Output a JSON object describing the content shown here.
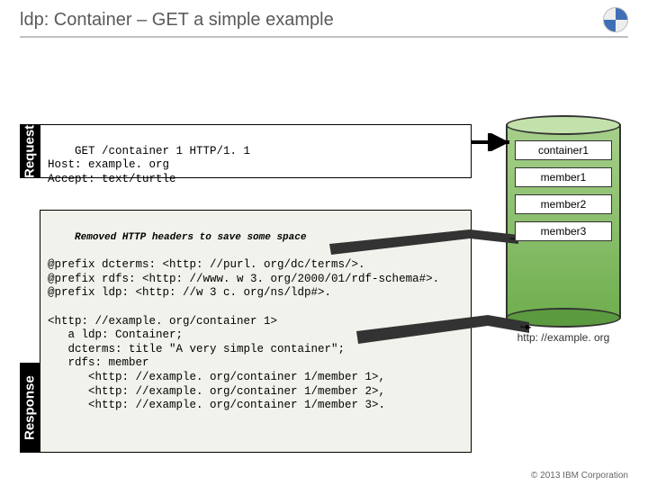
{
  "title": "ldp: Container – GET a simple example",
  "labels": {
    "request": "Request",
    "response": "Response"
  },
  "request_text": "GET /container 1 HTTP/1. 1\nHost: example. org\nAccept: text/turtle",
  "response_note": "Removed HTTP headers to save some space",
  "response_prefix": "@prefix dcterms: <http: //purl. org/dc/terms/>.\n@prefix rdfs: <http: //www. w 3. org/2000/01/rdf-schema#>.\n@prefix ldp: <http: //w 3 c. org/ns/ldp#>.",
  "response_body": "<http: //example. org/container 1>\n   a ldp: Container;\n   dcterms: title \"A very simple container\";\n   rdfs: member\n      <http: //example. org/container 1/member 1>,\n      <http: //example. org/container 1/member 2>,\n      <http: //example. org/container 1/member 3>.",
  "db": {
    "items": [
      "container1",
      "member1",
      "member2",
      "member3"
    ],
    "caption": "http: //example. org"
  },
  "copyright": "© 2013 IBM Corporation"
}
